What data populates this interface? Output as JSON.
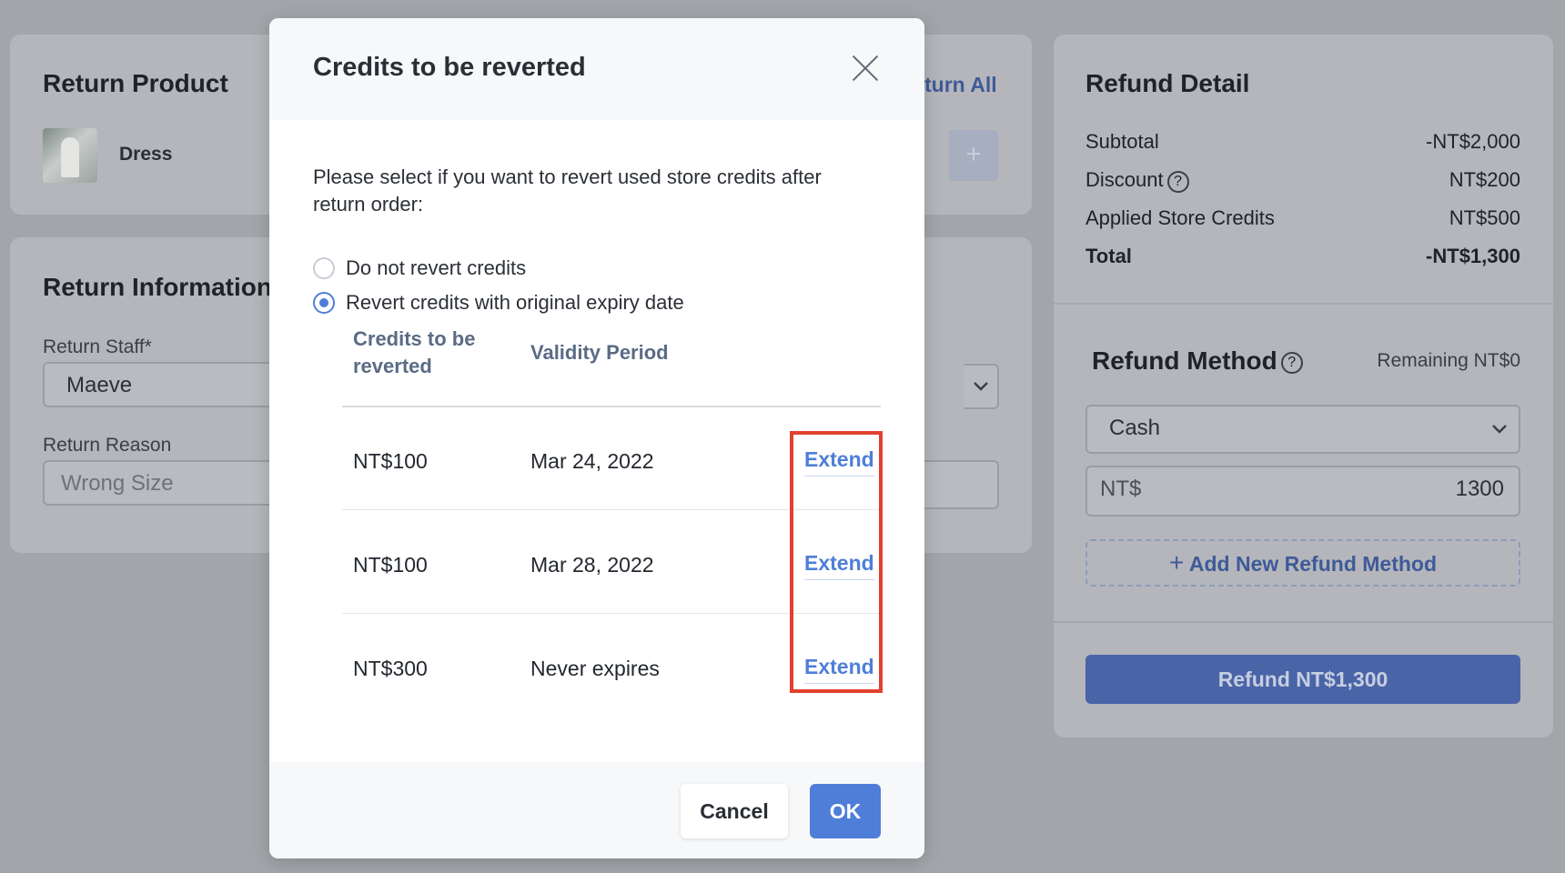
{
  "return_product": {
    "title": "Return Product",
    "product_name": "Dress",
    "return_all_label": "turn All"
  },
  "return_information": {
    "title": "Return Information",
    "staff_label": "Return Staff*",
    "staff_value": "Maeve",
    "reason_label": "Return Reason",
    "reason_placeholder": "Wrong Size"
  },
  "refund_detail": {
    "title": "Refund Detail",
    "rows": [
      {
        "label": "Subtotal",
        "value": "-NT$2,000"
      },
      {
        "label": "Discount",
        "value": "NT$200"
      },
      {
        "label": "Applied Store Credits",
        "value": "NT$500"
      },
      {
        "label": "Total",
        "value": "-NT$1,300"
      }
    ]
  },
  "refund_method": {
    "title": "Refund Method",
    "remaining": "Remaining NT$0",
    "method_value": "Cash",
    "currency_prefix": "NT$",
    "amount": "1300",
    "add_method_label": "Add New Refund Method",
    "refund_button": "Refund NT$1,300"
  },
  "modal": {
    "title": "Credits to be reverted",
    "description": "Please select if you want to revert used store credits after return order:",
    "options": [
      {
        "label": "Do not revert credits",
        "selected": false
      },
      {
        "label": "Revert credits with original expiry date",
        "selected": true
      }
    ],
    "table_headers": {
      "credits": "Credits to be reverted",
      "validity": "Validity Period"
    },
    "rows": [
      {
        "amount": "NT$100",
        "validity": "Mar 24, 2022",
        "action": "Extend"
      },
      {
        "amount": "NT$100",
        "validity": "Mar 28, 2022",
        "action": "Extend"
      },
      {
        "amount": "NT$300",
        "validity": "Never expires",
        "action": "Extend"
      }
    ],
    "cancel_label": "Cancel",
    "ok_label": "OK"
  },
  "colors": {
    "accent": "#4f7ed8",
    "highlight": "#e2412f",
    "overlay": "#a3a5aa"
  }
}
